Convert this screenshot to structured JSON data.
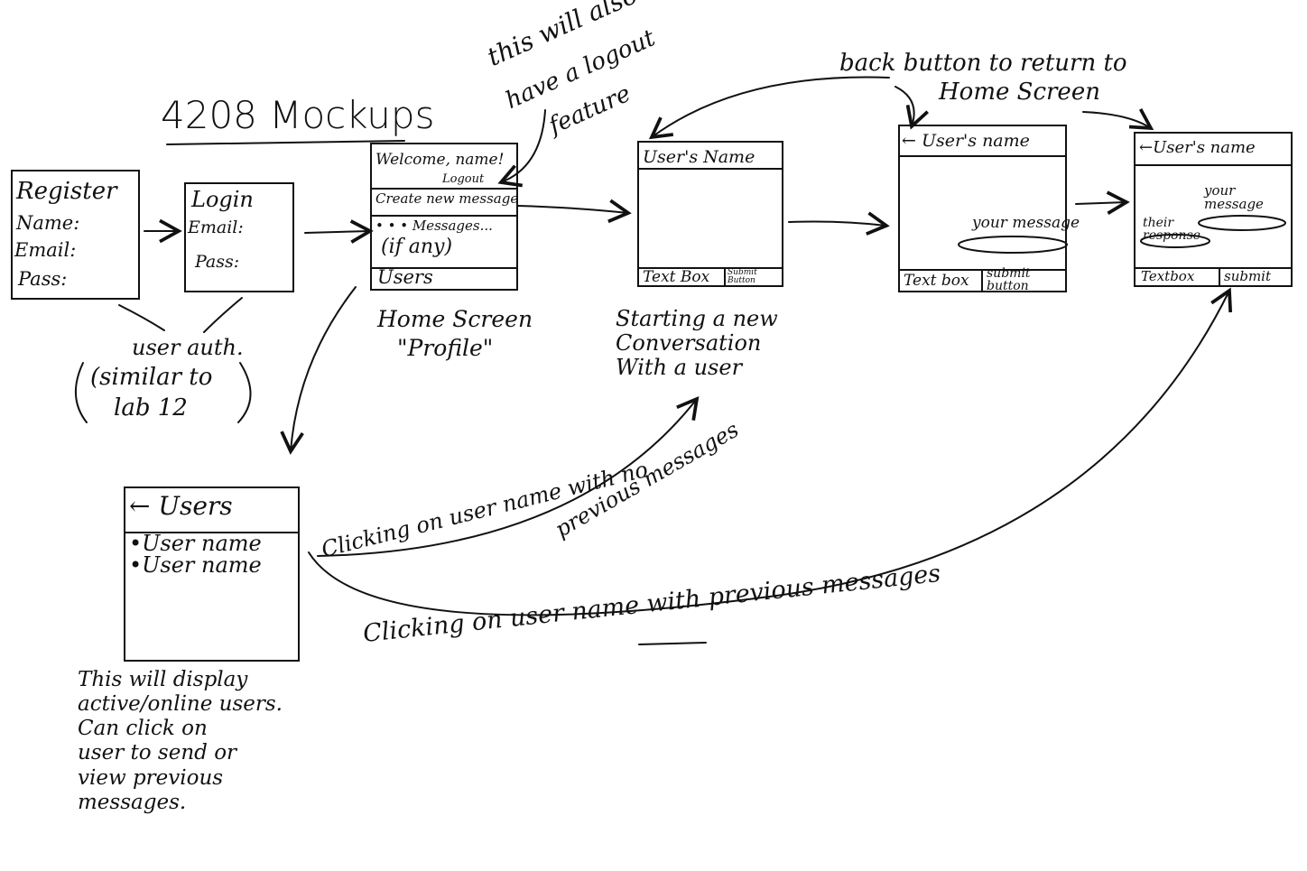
{
  "title": "4208 Mockups",
  "register": {
    "heading": "Register",
    "name_label": "Name:",
    "email_label": "Email:",
    "pass_label": "Pass:"
  },
  "login": {
    "heading": "Login",
    "email_label": "Email:",
    "pass_label": "Pass:"
  },
  "auth_note": {
    "line1": "user auth.",
    "line2": "(similar to",
    "line3": "lab 12"
  },
  "home": {
    "welcome": "Welcome, name!",
    "logout": "Logout",
    "create": "Create new message",
    "messages": "• • • Messages...",
    "if_any": "(if any)",
    "users": "Users",
    "caption1": "Home Screen",
    "caption2": "\"Profile\""
  },
  "logout_note": {
    "line1": "this will also",
    "line2": "have a logout",
    "line3": "feature"
  },
  "new_convo": {
    "header": "User's Name",
    "text_box": "Text Box",
    "submit": "Submit Button",
    "caption": "Starting a new\nConversation\nWith a user"
  },
  "back_note": {
    "line1": "back button to return to",
    "line2": "Home Screen"
  },
  "convo": {
    "header": "← User's name",
    "your_message": "your message",
    "text_box": "Text box",
    "submit": "submit button"
  },
  "reply": {
    "header": "←User's name",
    "your_message": "your message",
    "their_response": "their response",
    "text_box": "Textbox",
    "submit": "submit"
  },
  "users_screen": {
    "header": "← Users",
    "item1": "•User name",
    "item2": "•User name"
  },
  "users_note": "This will display\nactive/online users.\nCan click on\nuser to send or\nview previous\nmessages.",
  "no_prev_label": "Clicking on user name with no",
  "no_prev_label2": "previous messages",
  "with_prev_label": "Clicking on user name with previous messages"
}
